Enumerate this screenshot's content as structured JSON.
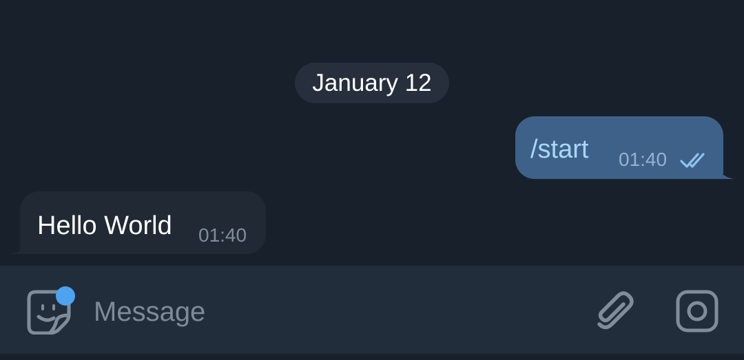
{
  "date_separator": "January 12",
  "messages": [
    {
      "direction": "outgoing",
      "text": "/start",
      "time": "01:40",
      "status_icon": "double-check-icon"
    },
    {
      "direction": "incoming",
      "text": "Hello World",
      "time": "01:40"
    }
  ],
  "composer": {
    "placeholder": "Message",
    "left_icon": "sticker-icon",
    "right_icons": [
      "attach-icon",
      "camera-icon"
    ]
  },
  "colors": {
    "background": "#18202b",
    "outgoing_bubble": "#3e6189",
    "incoming_bubble": "#212a34",
    "input_bar": "#212d3b",
    "accent_badge": "#4da3f0",
    "outgoing_text": "#a9d7ff"
  }
}
